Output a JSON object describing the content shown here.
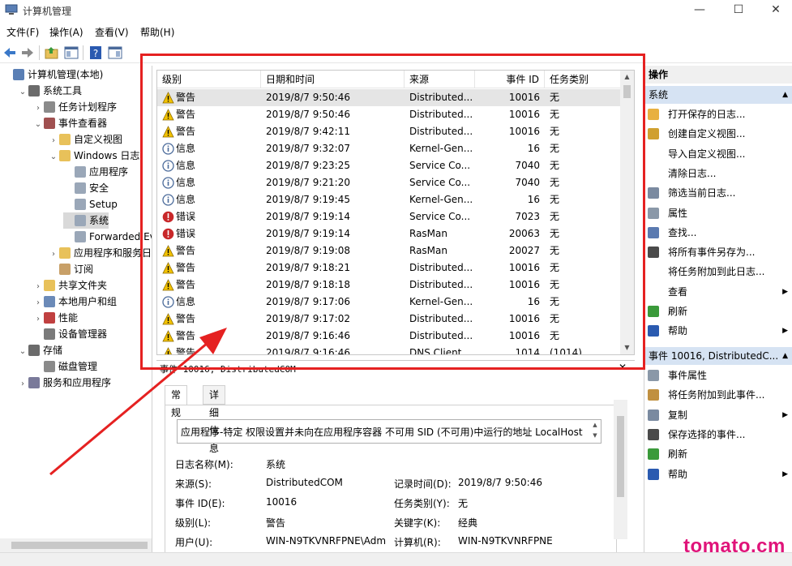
{
  "window": {
    "title": "计算机管理",
    "controls": [
      "—",
      "☐",
      "✕"
    ]
  },
  "menu": [
    "文件(F)",
    "操作(A)",
    "查看(V)",
    "帮助(H)"
  ],
  "tree": [
    {
      "label": "计算机管理(本地)",
      "arrow": "",
      "indent": 0,
      "icon": "computer-icon",
      "color": "#5a7fb5"
    },
    {
      "label": "系统工具",
      "arrow": "⌄",
      "indent": 1,
      "icon": "tools-icon",
      "color": "#6b6b6b"
    },
    {
      "label": "任务计划程序",
      "arrow": "›",
      "indent": 2,
      "icon": "clock-icon",
      "color": "#8a8a8a"
    },
    {
      "label": "事件查看器",
      "arrow": "⌄",
      "indent": 2,
      "icon": "event-viewer-icon",
      "color": "#a05050"
    },
    {
      "label": "自定义视图",
      "arrow": "›",
      "indent": 3,
      "icon": "folder-icon",
      "color": "#e8c15a"
    },
    {
      "label": "Windows 日志",
      "arrow": "⌄",
      "indent": 3,
      "icon": "folder-icon",
      "color": "#e8c15a"
    },
    {
      "label": "应用程序",
      "arrow": "",
      "indent": 4,
      "icon": "log-icon",
      "color": "#9aa7b8"
    },
    {
      "label": "安全",
      "arrow": "",
      "indent": 4,
      "icon": "log-icon",
      "color": "#9aa7b8"
    },
    {
      "label": "Setup",
      "arrow": "",
      "indent": 4,
      "icon": "log-icon",
      "color": "#9aa7b8"
    },
    {
      "label": "系统",
      "arrow": "",
      "indent": 4,
      "icon": "log-icon",
      "color": "#9aa7b8",
      "selected": true
    },
    {
      "label": "Forwarded Eve",
      "arrow": "",
      "indent": 4,
      "icon": "log-icon",
      "color": "#9aa7b8"
    },
    {
      "label": "应用程序和服务日志",
      "arrow": "›",
      "indent": 3,
      "icon": "folder-icon",
      "color": "#e8c15a"
    },
    {
      "label": "订阅",
      "arrow": "",
      "indent": 3,
      "icon": "subscription-icon",
      "color": "#c8a068"
    },
    {
      "label": "共享文件夹",
      "arrow": "›",
      "indent": 2,
      "icon": "shared-folder-icon",
      "color": "#e8c15a"
    },
    {
      "label": "本地用户和组",
      "arrow": "›",
      "indent": 2,
      "icon": "users-icon",
      "color": "#6b8ab8"
    },
    {
      "label": "性能",
      "arrow": "›",
      "indent": 2,
      "icon": "performance-icon",
      "color": "#c04040"
    },
    {
      "label": "设备管理器",
      "arrow": "",
      "indent": 2,
      "icon": "device-manager-icon",
      "color": "#7a7a7a"
    },
    {
      "label": "存储",
      "arrow": "⌄",
      "indent": 1,
      "icon": "storage-icon",
      "color": "#6b6b6b"
    },
    {
      "label": "磁盘管理",
      "arrow": "",
      "indent": 2,
      "icon": "disk-icon",
      "color": "#8a8a8a"
    },
    {
      "label": "服务和应用程序",
      "arrow": "›",
      "indent": 1,
      "icon": "services-icon",
      "color": "#7a7a9a"
    }
  ],
  "list": {
    "columns": [
      "级别",
      "日期和时间",
      "来源",
      "事件 ID",
      "任务类别"
    ],
    "rows": [
      {
        "level": "警告",
        "type": "warning",
        "date": "2019/8/7 9:50:46",
        "source": "Distributed...",
        "id": "10016",
        "task": "无"
      },
      {
        "level": "警告",
        "type": "warning",
        "date": "2019/8/7 9:50:46",
        "source": "Distributed...",
        "id": "10016",
        "task": "无"
      },
      {
        "level": "警告",
        "type": "warning",
        "date": "2019/8/7 9:42:11",
        "source": "Distributed...",
        "id": "10016",
        "task": "无"
      },
      {
        "level": "信息",
        "type": "info",
        "date": "2019/8/7 9:32:07",
        "source": "Kernel-Gen...",
        "id": "16",
        "task": "无"
      },
      {
        "level": "信息",
        "type": "info",
        "date": "2019/8/7 9:23:25",
        "source": "Service Co...",
        "id": "7040",
        "task": "无"
      },
      {
        "level": "信息",
        "type": "info",
        "date": "2019/8/7 9:21:20",
        "source": "Service Co...",
        "id": "7040",
        "task": "无"
      },
      {
        "level": "信息",
        "type": "info",
        "date": "2019/8/7 9:19:45",
        "source": "Kernel-Gen...",
        "id": "16",
        "task": "无"
      },
      {
        "level": "错误",
        "type": "error",
        "date": "2019/8/7 9:19:14",
        "source": "Service Co...",
        "id": "7023",
        "task": "无"
      },
      {
        "level": "错误",
        "type": "error",
        "date": "2019/8/7 9:19:14",
        "source": "RasMan",
        "id": "20063",
        "task": "无"
      },
      {
        "level": "警告",
        "type": "warning",
        "date": "2019/8/7 9:19:08",
        "source": "RasMan",
        "id": "20027",
        "task": "无"
      },
      {
        "level": "警告",
        "type": "warning",
        "date": "2019/8/7 9:18:21",
        "source": "Distributed...",
        "id": "10016",
        "task": "无"
      },
      {
        "level": "警告",
        "type": "warning",
        "date": "2019/8/7 9:18:18",
        "source": "Distributed...",
        "id": "10016",
        "task": "无"
      },
      {
        "level": "信息",
        "type": "info",
        "date": "2019/8/7 9:17:06",
        "source": "Kernel-Gen...",
        "id": "16",
        "task": "无"
      },
      {
        "level": "警告",
        "type": "warning",
        "date": "2019/8/7 9:17:02",
        "source": "Distributed...",
        "id": "10016",
        "task": "无"
      },
      {
        "level": "警告",
        "type": "warning",
        "date": "2019/8/7 9:16:46",
        "source": "Distributed...",
        "id": "10016",
        "task": "无"
      },
      {
        "level": "警告",
        "type": "warning",
        "date": "2019/8/7 9:16:46",
        "source": "DNS Client ...",
        "id": "1014",
        "task": "(1014)"
      }
    ]
  },
  "detail": {
    "title": "事件 10016, DistributedCOM",
    "close": "✕",
    "tabs": [
      "常规",
      "详细信息"
    ],
    "description": "应用程序-特定 权限设置并未向在应用程序容器 不可用 SID (不可用)中运行的地址 LocalHost",
    "fields": {
      "log_name_label": "日志名称(M):",
      "log_name": "系统",
      "source_label": "来源(S):",
      "source": "DistributedCOM",
      "logged_label": "记录时间(D):",
      "logged": "2019/8/7 9:50:46",
      "event_id_label": "事件 ID(E):",
      "event_id": "10016",
      "task_label": "任务类别(Y):",
      "task": "无",
      "level_label": "级别(L):",
      "level": "警告",
      "keywords_label": "关键字(K):",
      "keywords": "经典",
      "user_label": "用户(U):",
      "user": "WIN-N9TKVNRFPNE\\Adm",
      "computer_label": "计算机(R):",
      "computer": "WIN-N9TKVNRFPNE"
    }
  },
  "actions": {
    "header": "操作",
    "section1": "系统",
    "items1": [
      {
        "label": "打开保存的日志...",
        "icon": "open-folder-icon",
        "color": "#e8b040",
        "sub": ""
      },
      {
        "label": "创建自定义视图...",
        "icon": "filter-icon",
        "color": "#d0a030",
        "sub": ""
      },
      {
        "label": "导入自定义视图...",
        "icon": "",
        "color": "",
        "sub": ""
      },
      {
        "label": "清除日志...",
        "icon": "",
        "color": "",
        "sub": ""
      },
      {
        "label": "筛选当前日志...",
        "icon": "filter-icon",
        "color": "#7a8aa0",
        "sub": ""
      },
      {
        "label": "属性",
        "icon": "properties-icon",
        "color": "#8a98a8",
        "sub": ""
      },
      {
        "label": "查找...",
        "icon": "find-icon",
        "color": "#5a7ab0",
        "sub": ""
      },
      {
        "label": "将所有事件另存为...",
        "icon": "save-icon",
        "color": "#4a4a4a",
        "sub": ""
      },
      {
        "label": "将任务附加到此日志...",
        "icon": "",
        "color": "",
        "sub": ""
      },
      {
        "label": "查看",
        "icon": "",
        "color": "",
        "sub": "▶"
      },
      {
        "label": "刷新",
        "icon": "refresh-icon",
        "color": "#3a9a3a",
        "sub": ""
      },
      {
        "label": "帮助",
        "icon": "help-icon",
        "color": "#2a5ab0",
        "sub": "▶"
      }
    ],
    "section2": "事件 10016, DistributedC...",
    "items2": [
      {
        "label": "事件属性",
        "icon": "properties-icon",
        "color": "#8a98a8",
        "sub": ""
      },
      {
        "label": "将任务附加到此事件...",
        "icon": "task-icon",
        "color": "#c09040",
        "sub": ""
      },
      {
        "label": "复制",
        "icon": "copy-icon",
        "color": "#7a8aa0",
        "sub": "▶"
      },
      {
        "label": "保存选择的事件...",
        "icon": "save-icon",
        "color": "#4a4a4a",
        "sub": ""
      },
      {
        "label": "刷新",
        "icon": "refresh-icon",
        "color": "#3a9a3a",
        "sub": ""
      },
      {
        "label": "帮助",
        "icon": "help-icon",
        "color": "#2a5ab0",
        "sub": "▶"
      }
    ]
  },
  "watermark": "tomato.cm",
  "colors": {
    "annotation": "#e52121",
    "watermark": "#e0147a",
    "warning": "#f2c200",
    "info": "#4a6a9a",
    "error": "#c8282a"
  }
}
